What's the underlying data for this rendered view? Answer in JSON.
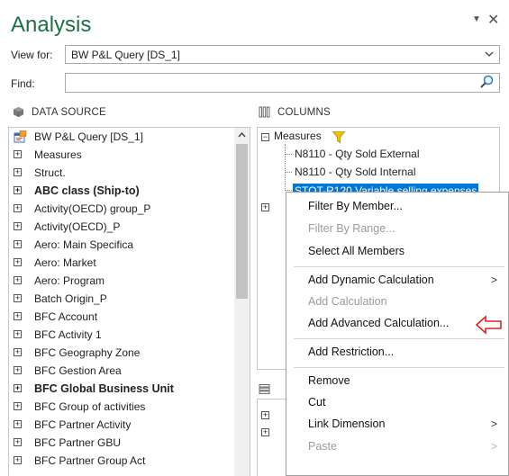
{
  "window": {
    "title": "Analysis",
    "pin_glyph": "▼",
    "close_glyph": "✕"
  },
  "view_for": {
    "label": "View for:",
    "value": "BW P&L Query [DS_1]"
  },
  "find": {
    "label": "Find:",
    "value": ""
  },
  "data_source": {
    "header": "DATA SOURCE",
    "root": "BW P&L Query [DS_1]",
    "items": [
      {
        "label": "Measures",
        "bold": false
      },
      {
        "label": "Struct.",
        "bold": false
      },
      {
        "label": "ABC class (Ship-to)",
        "bold": true
      },
      {
        "label": "Activity(OECD) group_P",
        "bold": false
      },
      {
        "label": "Activity(OECD)_P",
        "bold": false
      },
      {
        "label": "Aero: Main Specifica",
        "bold": false
      },
      {
        "label": "Aero: Market",
        "bold": false
      },
      {
        "label": "Aero: Program",
        "bold": false
      },
      {
        "label": "Batch Origin_P",
        "bold": false
      },
      {
        "label": "BFC Account",
        "bold": false
      },
      {
        "label": "BFC Activity 1",
        "bold": false
      },
      {
        "label": "BFC Geography Zone",
        "bold": false
      },
      {
        "label": "BFC Gestion Area",
        "bold": false
      },
      {
        "label": "BFC Global Business Unit",
        "bold": true
      },
      {
        "label": "BFC Group of activities",
        "bold": false
      },
      {
        "label": "BFC Partner Activity",
        "bold": false
      },
      {
        "label": "BFC Partner GBU",
        "bold": false
      },
      {
        "label": "BFC Partner Group Act",
        "bold": false
      }
    ]
  },
  "columns": {
    "header": "COLUMNS",
    "root": "Measures",
    "children": [
      "N8110 - Qty Sold External",
      "N8110 - Qty Sold Internal",
      "STOT-R120 Variable selling expenses"
    ]
  },
  "context_menu": {
    "items": [
      {
        "label": "Filter By Member...",
        "disabled": false,
        "submenu": false
      },
      {
        "label": "Filter By Range...",
        "disabled": true,
        "submenu": false
      },
      {
        "label": "Select All Members",
        "disabled": false,
        "submenu": false
      },
      {
        "label": "Add Dynamic Calculation",
        "disabled": false,
        "submenu": true
      },
      {
        "label": "Add Calculation",
        "disabled": true,
        "submenu": false
      },
      {
        "label": "Add Advanced Calculation...",
        "disabled": false,
        "submenu": false
      },
      {
        "label": "Add Restriction...",
        "disabled": false,
        "submenu": false
      },
      {
        "label": "Remove",
        "disabled": false,
        "submenu": false
      },
      {
        "label": "Cut",
        "disabled": false,
        "submenu": false
      },
      {
        "label": "Link Dimension",
        "disabled": false,
        "submenu": true
      },
      {
        "label": "Paste",
        "disabled": true,
        "submenu": true
      }
    ],
    "submenu_arrow": ">"
  },
  "colors": {
    "title_green": "#1e7145",
    "selection_blue": "#0078d7",
    "annotation_red": "#e02020",
    "funnel_yellow": "#f2c200"
  }
}
